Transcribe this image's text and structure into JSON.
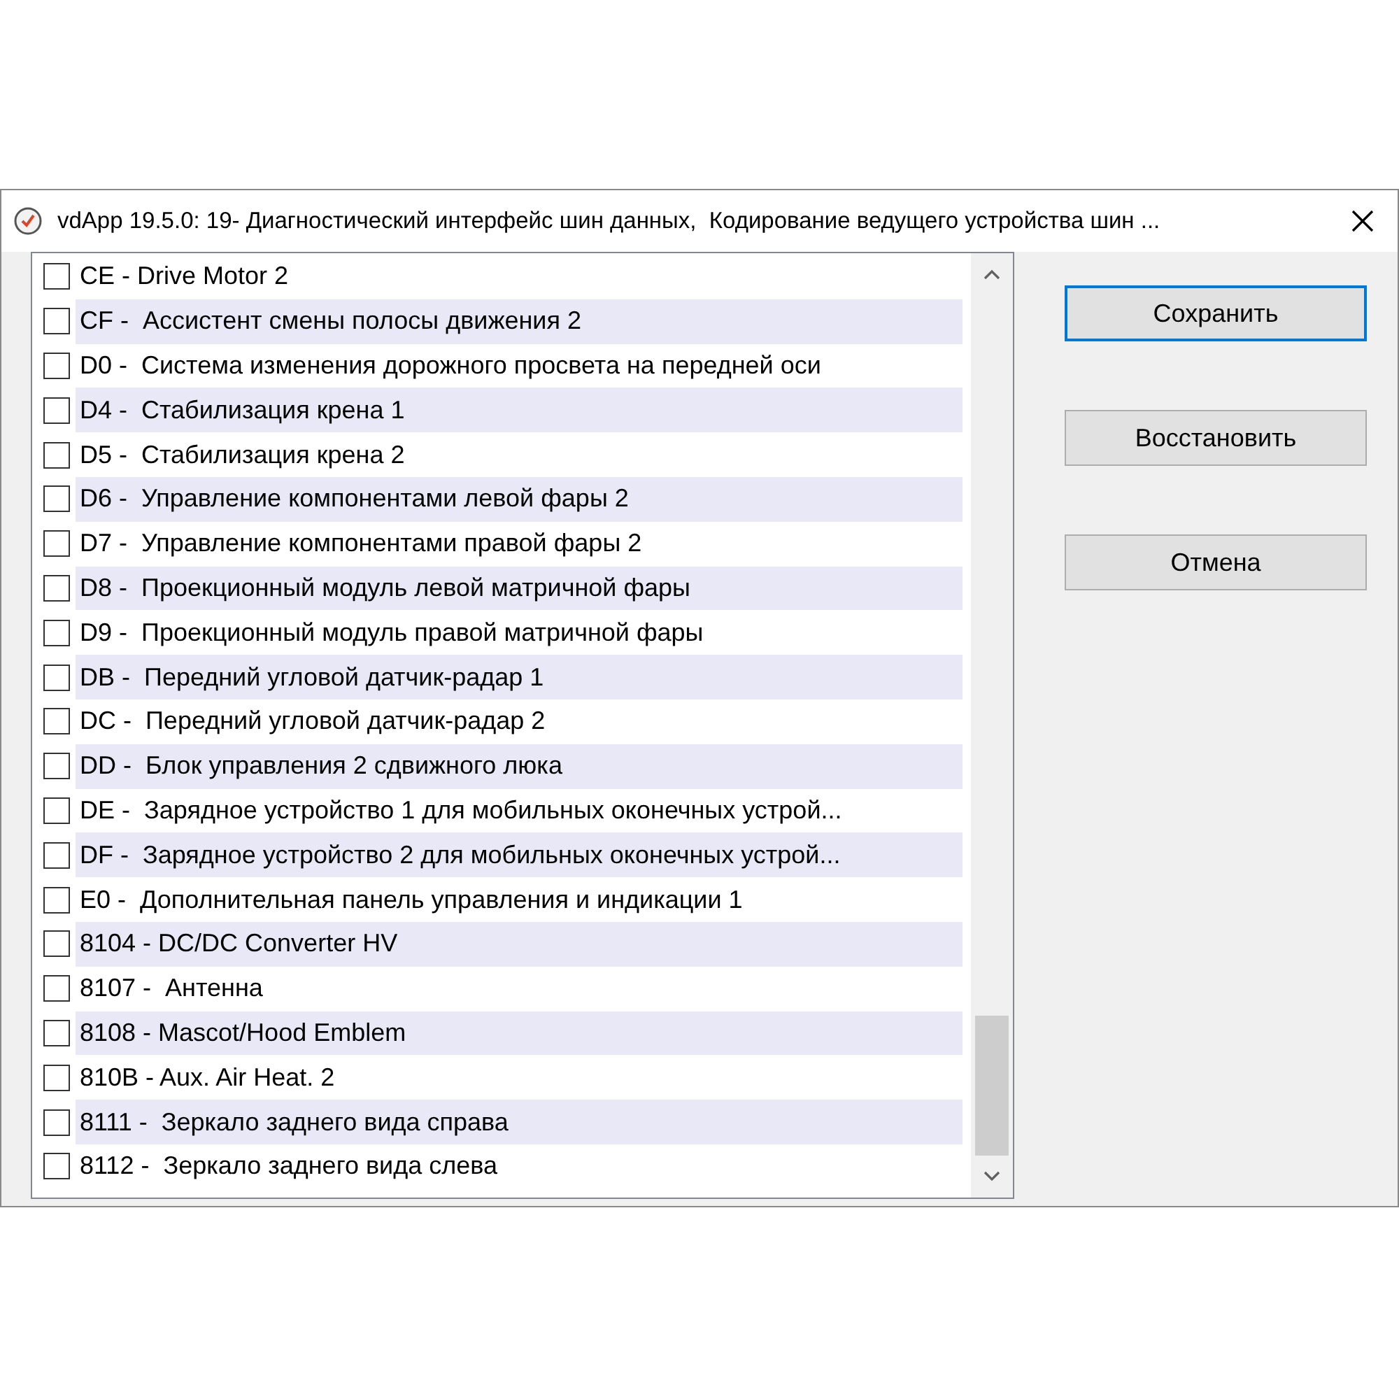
{
  "window": {
    "title": "vdApp 19.5.0: 19- Диагностический интерфейс шин данных,  Кодирование ведущего устройства шин ..."
  },
  "list": {
    "items": [
      {
        "label": "CE - Drive Motor 2",
        "checked": false
      },
      {
        "label": "CF -  Ассистент смены полосы движения 2",
        "checked": false
      },
      {
        "label": "D0 -  Система изменения дорожного просвета на передней оси",
        "checked": false
      },
      {
        "label": "D4 -  Стабилизация крена 1",
        "checked": false
      },
      {
        "label": "D5 -  Стабилизация крена 2",
        "checked": false
      },
      {
        "label": "D6 -  Управление компонентами левой фары 2",
        "checked": false
      },
      {
        "label": "D7 -  Управление компонентами правой фары 2",
        "checked": false
      },
      {
        "label": "D8 -  Проекционный модуль левой матричной фары",
        "checked": false
      },
      {
        "label": "D9 -  Проекционный модуль правой матричной фары",
        "checked": false
      },
      {
        "label": "DB -  Передний угловой датчик-радар 1",
        "checked": false
      },
      {
        "label": "DC -  Передний угловой датчик-радар 2",
        "checked": false
      },
      {
        "label": "DD -  Блок управления 2 сдвижного люка",
        "checked": false
      },
      {
        "label": "DE -  Зарядное устройство 1 для мобильных оконечных устрой...",
        "checked": false
      },
      {
        "label": "DF -  Зарядное устройство 2 для мобильных оконечных устрой...",
        "checked": false
      },
      {
        "label": "E0 -  Дополнительная панель управления и индикации 1",
        "checked": false
      },
      {
        "label": "8104 - DC/DC Converter HV",
        "checked": false
      },
      {
        "label": "8107 -  Антенна",
        "checked": false
      },
      {
        "label": "8108 - Mascot/Hood Emblem",
        "checked": false
      },
      {
        "label": "810B - Aux. Air Heat. 2",
        "checked": false
      },
      {
        "label": "8111 -  Зеркало заднего вида справа",
        "checked": false
      },
      {
        "label": "8112 -  Зеркало заднего вида слева",
        "checked": false
      }
    ]
  },
  "buttons": [
    {
      "label": "Сохранить",
      "selected": true
    },
    {
      "label": "Восстановить",
      "selected": false
    },
    {
      "label": "Отмена",
      "selected": false
    }
  ]
}
